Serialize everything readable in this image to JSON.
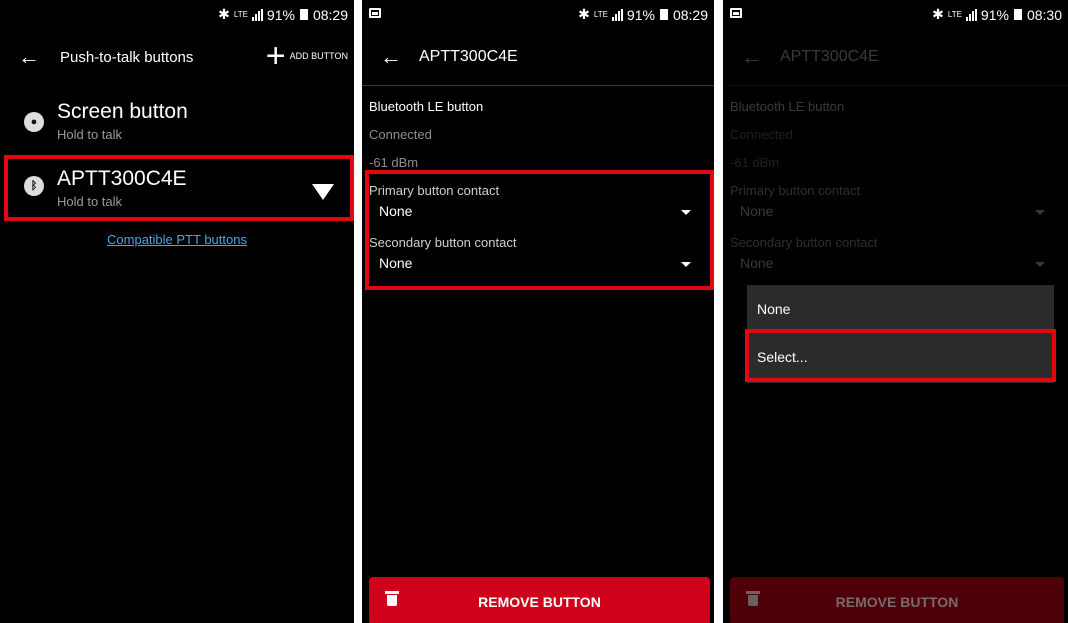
{
  "screens": [
    {
      "status": {
        "time": "08:29",
        "battery": "91%",
        "network": "LTE"
      },
      "appbar": {
        "title": "Push-to-talk buttons",
        "add_label": "ADD BUTTON"
      },
      "items": [
        {
          "name": "Screen button",
          "sub": "Hold to talk",
          "icon": "microphone-icon"
        },
        {
          "name": "APTT300C4E",
          "sub": "Hold to talk",
          "icon": "bluetooth-icon",
          "signal_icon": "wifi-signal-icon"
        }
      ],
      "link": "Compatible PTT buttons"
    },
    {
      "status": {
        "time": "08:29",
        "battery": "91%",
        "network": "LTE"
      },
      "appbar": {
        "title": "APTT300C4E"
      },
      "type": "Bluetooth LE button",
      "state": "Connected",
      "rssi": "-61 dBm",
      "primary": {
        "label": "Primary button contact",
        "value": "None"
      },
      "secondary": {
        "label": "Secondary button contact",
        "value": "None"
      },
      "remove": "REMOVE BUTTON"
    },
    {
      "status": {
        "time": "08:30",
        "battery": "91%",
        "network": "LTE"
      },
      "appbar": {
        "title": "APTT300C4E"
      },
      "type": "Bluetooth LE button",
      "state": "Connected",
      "rssi": "-61 dBm",
      "primary": {
        "label": "Primary button contact",
        "value": "None"
      },
      "secondary": {
        "label": "Secondary button contact",
        "value": "None"
      },
      "menu": [
        "None",
        "Select..."
      ],
      "remove": "REMOVE BUTTON"
    }
  ],
  "colors": {
    "highlight": "#e30613",
    "danger": "#d0021b",
    "link": "#4aa6e6"
  }
}
